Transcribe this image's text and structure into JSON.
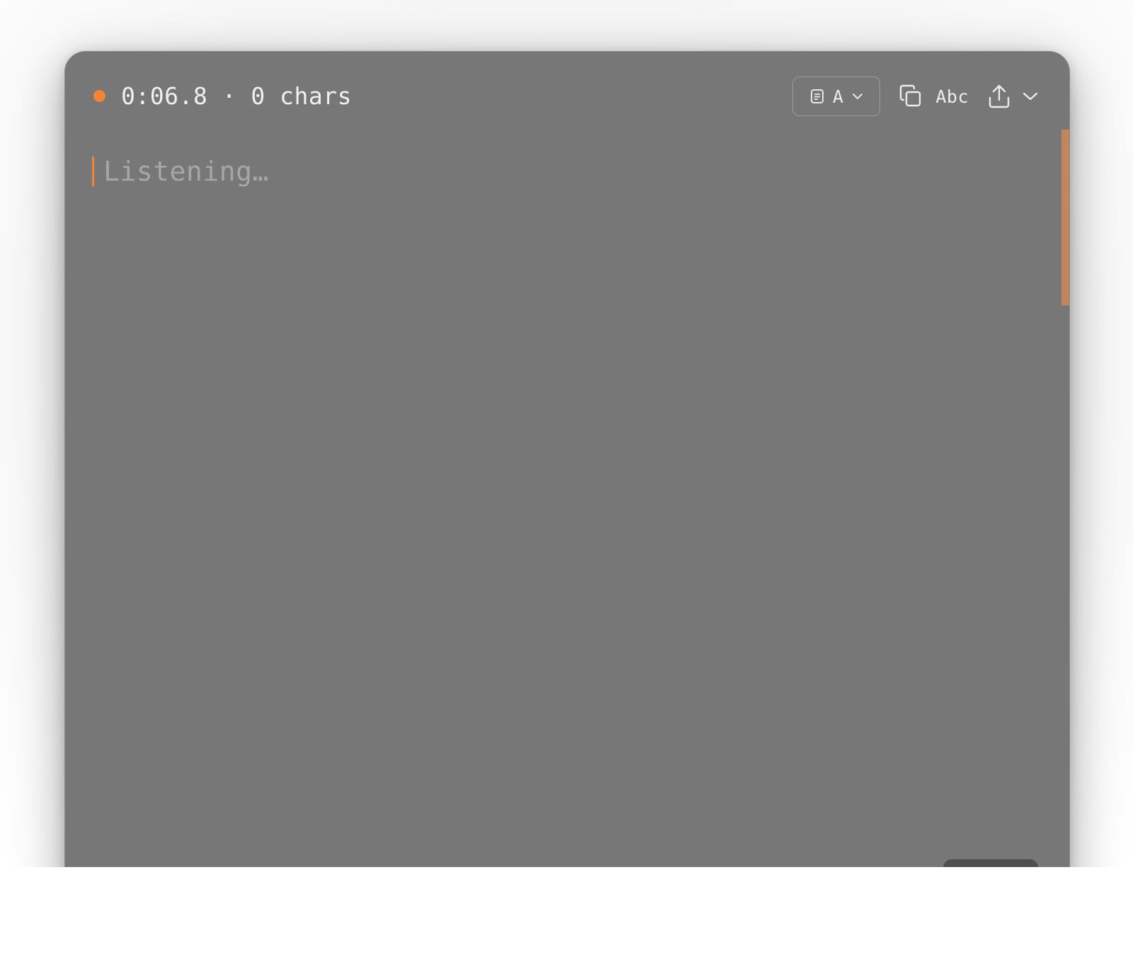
{
  "header": {
    "recording_indicator": "recording",
    "status_text": "0:06.8 · 0 chars"
  },
  "toolbar": {
    "mode_select_value": "A",
    "mode_icon": "document-icon",
    "copy_icon": "copy-icon",
    "abc_label": "Abc",
    "export_icon": "share-upload-icon",
    "export_menu_icon": "chevron-down-icon"
  },
  "editor": {
    "placeholder": "Listening…"
  },
  "colors": {
    "accent": "#f58435",
    "window_bg": "#777777",
    "scrollbar": "#c2865e"
  }
}
